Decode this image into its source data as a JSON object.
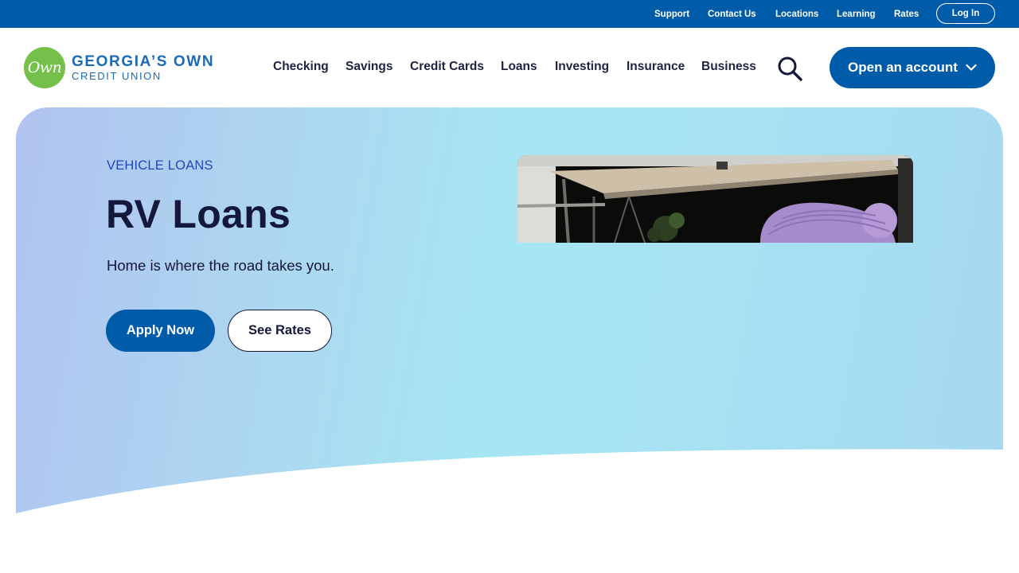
{
  "utility_nav": {
    "links": [
      "Support",
      "Contact Us",
      "Locations",
      "Learning",
      "Rates"
    ],
    "login_label": "Log In"
  },
  "header": {
    "logo": {
      "mark": "Own",
      "name_line1": "GEORGIA’S OWN",
      "name_line2": "CREDIT UNION"
    },
    "nav": [
      "Checking",
      "Savings",
      "Credit Cards",
      "Loans",
      "Investing",
      "Insurance",
      "Business"
    ],
    "search_icon": "search-icon",
    "cta_label": "Open an account",
    "cta_icon": "chevron-down-icon"
  },
  "hero": {
    "eyebrow": "VEHICLE LOANS",
    "title": "RV Loans",
    "subtitle": "Home is where the road takes you.",
    "primary_button": "Apply Now",
    "secondary_button": "See Rates"
  },
  "colors": {
    "brand_blue": "#005ca9",
    "logo_green": "#74c04a",
    "navy_text": "#14183a",
    "eyebrow_blue": "#2347b8"
  }
}
